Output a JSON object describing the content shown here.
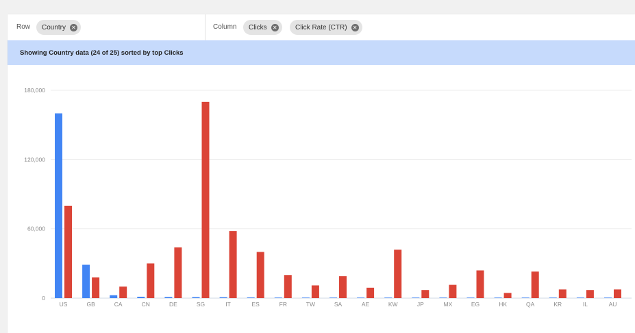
{
  "toolbar": {
    "row_label": "Row",
    "row_chip": "Country",
    "column_label": "Column",
    "column_chips": [
      "Clicks",
      "Click Rate (CTR)"
    ]
  },
  "banner": {
    "text": "Showing Country data (24 of 25) sorted by top Clicks"
  },
  "icons": {
    "chip_remove": "close-circle-icon"
  },
  "colors": {
    "clicks": "#4285f4",
    "ctr": "#db4437",
    "banner": "#c6dafc"
  },
  "chart_data": {
    "type": "bar",
    "categories": [
      "US",
      "GB",
      "CA",
      "CN",
      "DE",
      "SG",
      "IT",
      "ES",
      "FR",
      "TW",
      "SA",
      "AE",
      "KW",
      "JP",
      "MX",
      "EG",
      "HK",
      "QA",
      "KR",
      "IL",
      "AU"
    ],
    "series": [
      {
        "name": "",
        "color": "#4285f4",
        "values": [
          160000,
          29000,
          2500,
          1200,
          1000,
          900,
          800,
          600,
          500,
          400,
          350,
          300,
          250,
          200,
          180,
          150,
          130,
          110,
          100,
          90,
          80
        ]
      },
      {
        "name": "",
        "color": "#db4437",
        "values": [
          80000,
          18000,
          10000,
          30000,
          44000,
          170000,
          58000,
          40000,
          20000,
          11000,
          19000,
          9000,
          42000,
          7000,
          11500,
          24000,
          4500,
          23000,
          7500,
          7000,
          7500
        ]
      }
    ],
    "yticks": [
      "0",
      "60,000",
      "120,000",
      "180,000"
    ],
    "ylim": [
      0,
      180000
    ],
    "grid": true
  }
}
